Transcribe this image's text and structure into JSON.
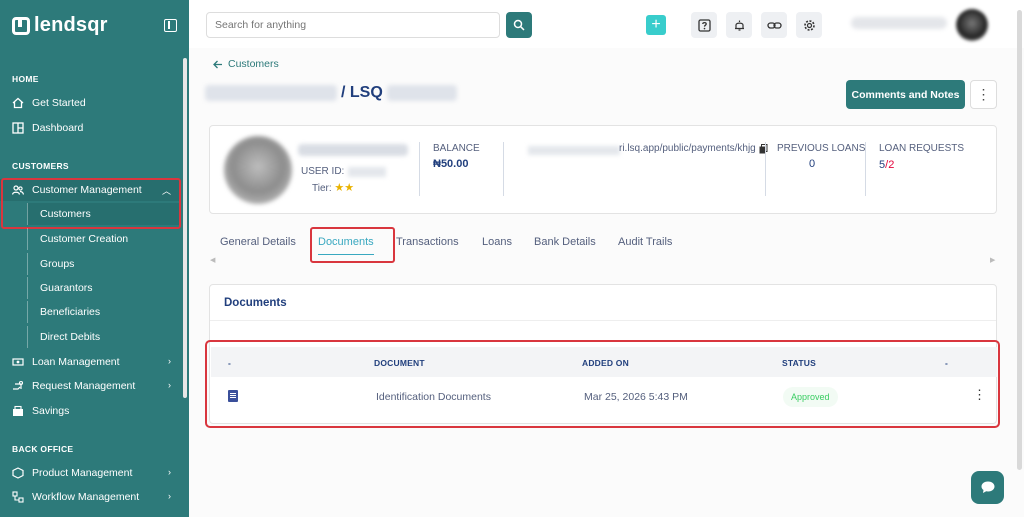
{
  "brand": {
    "name": "lendsqr"
  },
  "sidebar": {
    "sections": {
      "home": "HOME",
      "customers": "CUSTOMERS",
      "back_office": "BACK OFFICE"
    },
    "items": {
      "get_started": "Get Started",
      "dashboard": "Dashboard",
      "customer_management": "Customer Management",
      "customers": "Customers",
      "customer_creation": "Customer Creation",
      "groups": "Groups",
      "guarantors": "Guarantors",
      "beneficiaries": "Beneficiaries",
      "direct_debits": "Direct Debits",
      "loan_management": "Loan Management",
      "request_management": "Request Management",
      "savings": "Savings",
      "product_management": "Product Management",
      "workflow_management": "Workflow Management"
    }
  },
  "topbar": {
    "search_placeholder": "Search for anything",
    "add_label": "+"
  },
  "page": {
    "back_label": "Customers",
    "title_suffix": "/ LSQ",
    "comments_button": "Comments and Notes"
  },
  "customer": {
    "user_id_label": "USER ID:",
    "tier_label": "Tier:",
    "tier_stars": "★★",
    "balance_label": "BALANCE",
    "balance_value": "₦50.00",
    "payment_link": "ri.lsq.app/public/payments/khjg",
    "previous_loans_label": "PREVIOUS LOANS",
    "previous_loans_value": "0",
    "loan_requests_label": "LOAN REQUESTS",
    "loan_requests_value": "5",
    "loan_requests_slash": "/",
    "loan_requests_pending": "2"
  },
  "tabs": {
    "general": "General Details",
    "documents": "Documents",
    "transactions": "Transactions",
    "loans": "Loans",
    "bank": "Bank Details",
    "audit": "Audit Trails"
  },
  "documents": {
    "title": "Documents",
    "columns": [
      "-",
      "DOCUMENT",
      "ADDED ON",
      "STATUS",
      "-"
    ],
    "rows": [
      {
        "document": "Identification Documents",
        "added_on": "Mar 25, 2026 5:43 PM",
        "status": "Approved"
      }
    ]
  },
  "colors": {
    "sidebar": "#2d7a7a",
    "accent": "#39cdcc",
    "primary_text": "#213f7d",
    "highlight": "#d9363e",
    "approved": "#39cd62"
  }
}
